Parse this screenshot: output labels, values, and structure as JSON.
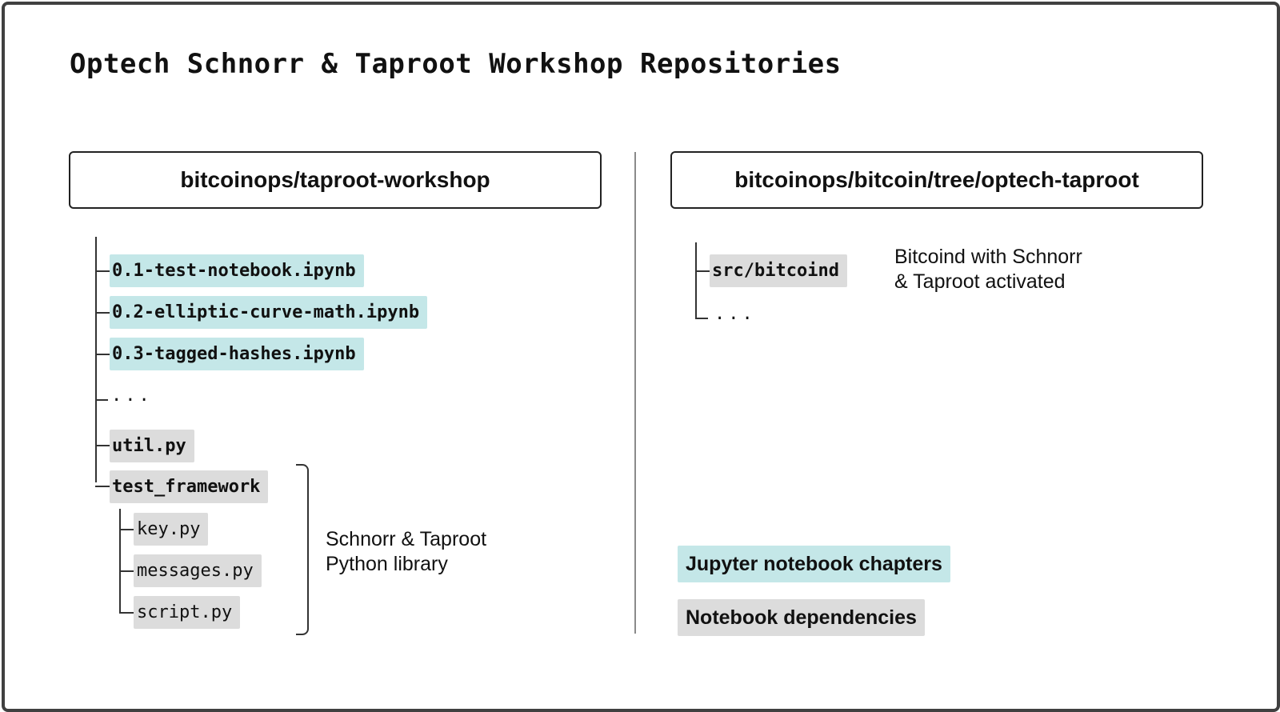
{
  "title": "Optech Schnorr & Taproot Workshop Repositories",
  "colors": {
    "notebook": "#c4e7e8",
    "dependency": "#dcdcdc",
    "border": "#404040"
  },
  "left_repo": {
    "name": "bitcoinops/taproot-workshop",
    "notebooks": [
      "0.1-test-notebook.ipynb",
      "0.2-elliptic-curve-math.ipynb",
      "0.3-tagged-hashes.ipynb"
    ],
    "ellipsis": "...",
    "util": "util.py",
    "test_framework": {
      "name": "test_framework",
      "files": [
        "key.py",
        "messages.py",
        "script.py"
      ]
    },
    "library_note": {
      "line1": "Schnorr & Taproot",
      "line2": "Python library"
    }
  },
  "right_repo": {
    "name": "bitcoinops/bitcoin/tree/optech-taproot",
    "binary": "src/bitcoind",
    "ellipsis": "...",
    "binary_note": {
      "line1": "Bitcoind with Schnorr",
      "line2": "& Taproot activated"
    }
  },
  "legend": {
    "notebooks": "Jupyter notebook chapters",
    "dependencies": "Notebook dependencies"
  }
}
